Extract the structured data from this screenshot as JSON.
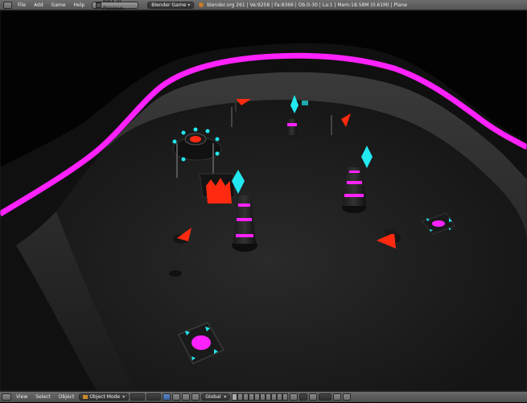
{
  "topbar": {
    "menus": [
      "File",
      "Add",
      "Game",
      "Help"
    ],
    "back_button": "Back to Previous",
    "engine": "Blender Game",
    "stats": "blender.org 261 | Ve:9258 | Fa:8366 | Ob:0-30 | La:1 | Mem:18.58M (0.61M) | Plane"
  },
  "bottombar": {
    "menus": [
      "View",
      "Select",
      "Object"
    ],
    "mode": "Object Mode",
    "orientation": "Global"
  },
  "colors": {
    "accent_magenta": "#ff22ff",
    "accent_cyan": "#22e8f0",
    "accent_red": "#ff2a10",
    "ui_blue": "#4a74b4"
  },
  "icons": [
    "blender-logo-icon",
    "viewport-shading-icon",
    "pivot-icon",
    "manipulator-icon",
    "layers-icon",
    "lock-icon",
    "snap-icon",
    "render-icon"
  ]
}
